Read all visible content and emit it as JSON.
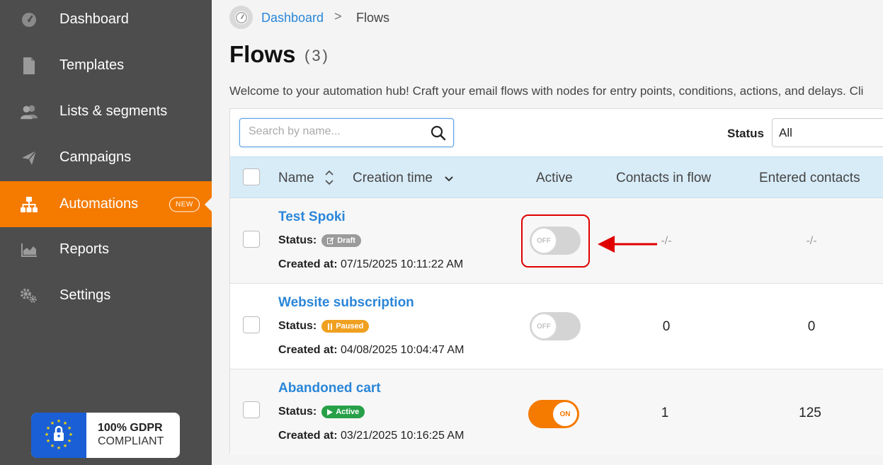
{
  "sidebar": {
    "items": [
      {
        "label": "Dashboard",
        "icon": "speedometer-icon"
      },
      {
        "label": "Templates",
        "icon": "document-icon"
      },
      {
        "label": "Lists & segments",
        "icon": "users-icon"
      },
      {
        "label": "Campaigns",
        "icon": "paper-plane-icon"
      },
      {
        "label": "Automations",
        "icon": "sitemap-icon",
        "badge": "NEW",
        "active": true
      },
      {
        "label": "Reports",
        "icon": "area-chart-icon"
      },
      {
        "label": "Settings",
        "icon": "gears-icon"
      }
    ],
    "gdpr": {
      "line1": "100% GDPR",
      "line2": "COMPLIANT"
    }
  },
  "breadcrumb": {
    "home": "Dashboard",
    "separator": ">",
    "current": "Flows"
  },
  "page": {
    "title": "Flows",
    "count": "(3)",
    "intro": "Welcome to your automation hub! Craft your email flows with nodes for entry points, conditions, actions, and delays. Cli"
  },
  "toolbar": {
    "search_placeholder": "Search by name...",
    "status_label": "Status",
    "status_value": "All"
  },
  "table": {
    "columns": {
      "name": "Name",
      "creation_time": "Creation time",
      "active": "Active",
      "contacts_in_flow": "Contacts in flow",
      "entered_contacts": "Entered contacts"
    },
    "status_key": "Status:",
    "created_key": "Created at:",
    "rows": [
      {
        "name": "Test Spoki",
        "status": "Draft",
        "created": "07/15/2025 10:11:22 AM",
        "toggle": "OFF",
        "contacts_in_flow": "-/-",
        "entered_contacts": "-/-"
      },
      {
        "name": "Website subscription",
        "status": "Paused",
        "created": "04/08/2025 10:04:47 AM",
        "toggle": "OFF",
        "contacts_in_flow": "0",
        "entered_contacts": "0"
      },
      {
        "name": "Abandoned cart",
        "status": "Active",
        "created": "03/21/2025 10:16:25 AM",
        "toggle": "ON",
        "contacts_in_flow": "1",
        "entered_contacts": "125"
      }
    ]
  },
  "colors": {
    "sidebar_bg": "#4d4d4d",
    "accent": "#f47a00",
    "link": "#2a86d8",
    "header_bg": "#d8ecf8",
    "annotation": "#e00000"
  }
}
